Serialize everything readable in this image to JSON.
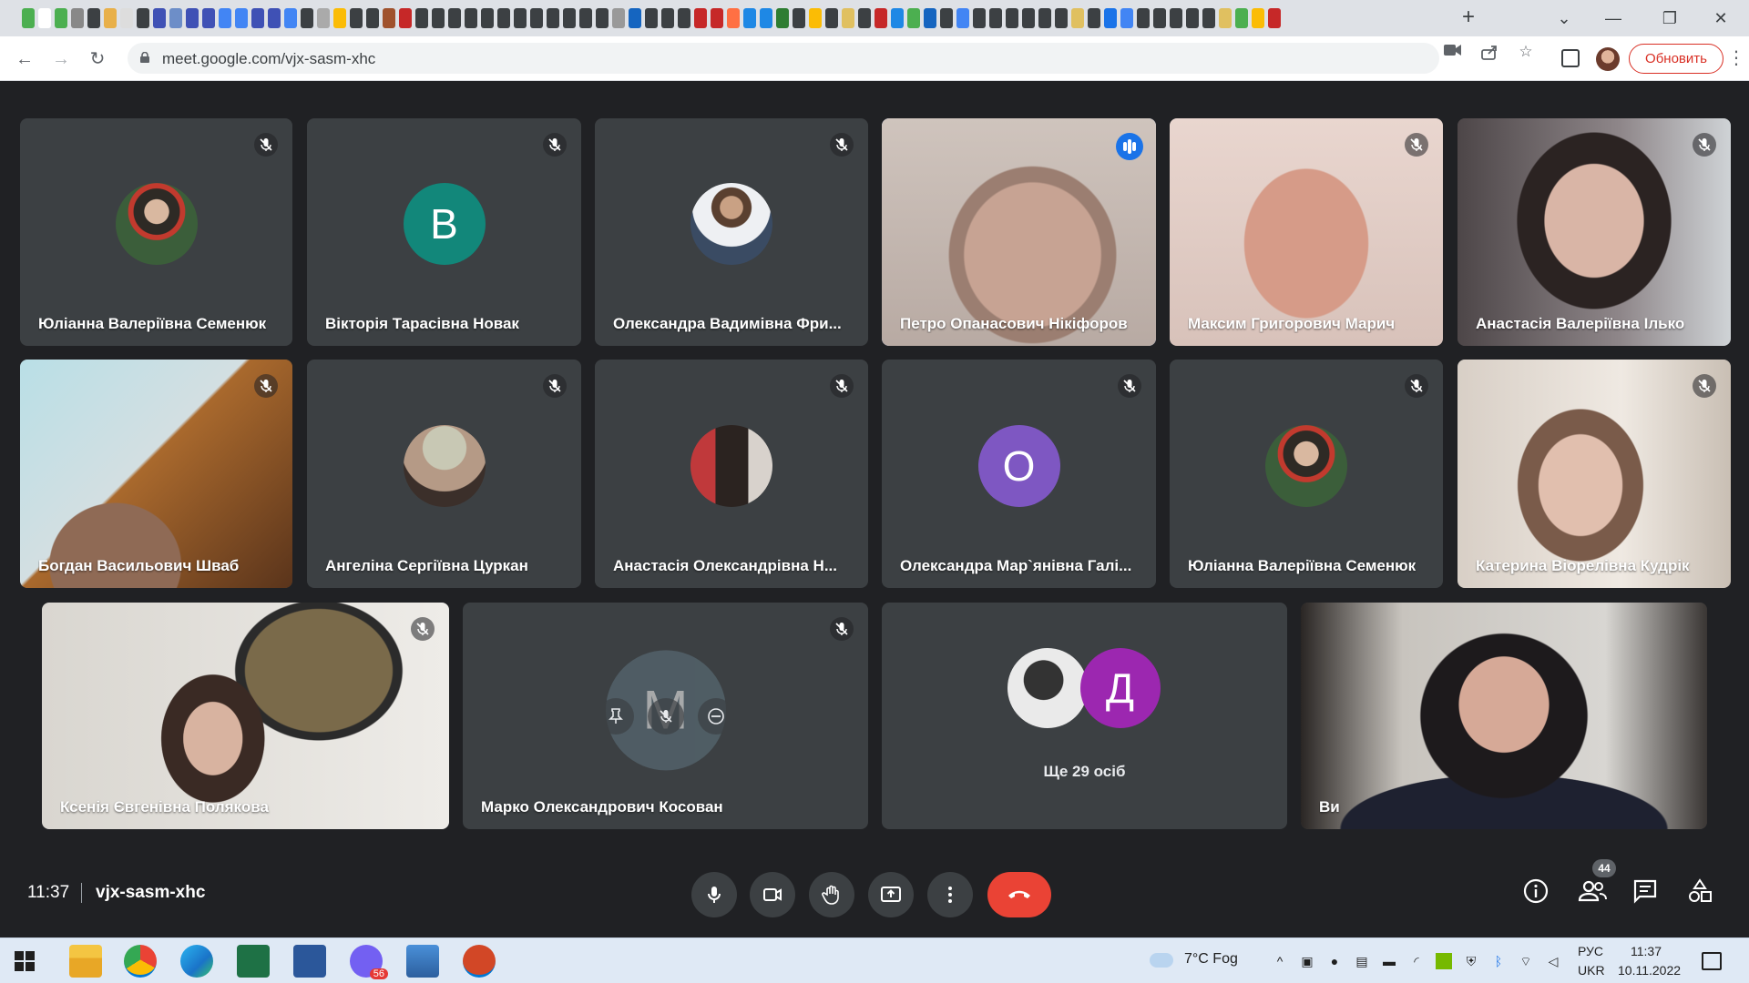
{
  "browser": {
    "url": "meet.google.com/vjx-sasm-xhc",
    "update_label": "Обновить",
    "tab_icon_colors": [
      "#4caf50",
      "#ffffff",
      "#4caf50",
      "#888",
      "#3c4043",
      "#e8b04a",
      "#ddd",
      "#3c4043",
      "#3f51b5",
      "#6d8ec8",
      "#3f51b5",
      "#3f51b5",
      "#4285f4",
      "#4285f4",
      "#3f51b5",
      "#3f51b5",
      "#4285f4",
      "#3c4043",
      "#aaa",
      "#fbbc05",
      "#3c4043",
      "#3c4043",
      "#a0522d",
      "#c62828",
      "#3c4043",
      "#3c4043",
      "#3c4043",
      "#3c4043",
      "#3c4043",
      "#3c4043",
      "#3c4043",
      "#3c4043",
      "#3c4043",
      "#3c4043",
      "#3c4043",
      "#3c4043",
      "#999",
      "#1565c0",
      "#3c4043",
      "#3c4043",
      "#3c4043",
      "#c62828",
      "#c62828",
      "#ff7043",
      "#1e88e5",
      "#1e88e5",
      "#2e7d32",
      "#3c4043",
      "#fbbc05",
      "#3c4043",
      "#e0c060",
      "#3c4043",
      "#c62828",
      "#1e88e5",
      "#4caf50",
      "#1565c0",
      "#3c4043",
      "#4285f4",
      "#3c4043",
      "#3c4043",
      "#3c4043",
      "#3c4043",
      "#3c4043",
      "#3c4043",
      "#e0c060",
      "#3c4043",
      "#1a73e8",
      "#4285f4",
      "#3c4043",
      "#3c4043",
      "#3c4043",
      "#3c4043",
      "#3c4043",
      "#e0c060",
      "#4caf50",
      "#fbbc05",
      "#c62828"
    ]
  },
  "participants": [
    {
      "name": "Юліанна Валеріївна Семенюк",
      "kind": "photo",
      "photo_color": "#3b5e3a"
    },
    {
      "name": "Вікторія Тарасівна Новак",
      "kind": "letter",
      "letter": "В",
      "color": "#12877a"
    },
    {
      "name": "Олександра Вадимівна Фри...",
      "kind": "photo",
      "photo_color": "#8a7060"
    },
    {
      "name": "Петро Опанасович Нікіфоров",
      "kind": "video",
      "speaking": true
    },
    {
      "name": "Максим Григорович Марич",
      "kind": "video"
    },
    {
      "name": "Анастасія Валеріївна Ілько",
      "kind": "video"
    },
    {
      "name": "Богдан Васильович Шваб",
      "kind": "video"
    },
    {
      "name": "Ангеліна Сергіївна Цуркан",
      "kind": "photo",
      "photo_color": "#c8c8b4"
    },
    {
      "name": "Анастасія Олександрівна Н...",
      "kind": "photo",
      "photo_color": "#4a3b33"
    },
    {
      "name": "Олександра Мар`янівна Галі...",
      "kind": "letter",
      "letter": "О",
      "color": "#7e57c2"
    },
    {
      "name": "Юліанна Валеріївна Семенюк",
      "kind": "photo",
      "photo_color": "#3b5e3a"
    },
    {
      "name": "Катерина Віорелівна Кудрік",
      "kind": "video"
    },
    {
      "name": "Ксенія Євгенівна Полякова",
      "kind": "video"
    },
    {
      "name": "Марко Олександрович Косован",
      "kind": "letter",
      "letter": "М",
      "color": "#5f7480"
    },
    {
      "more_label": "Ще 29 осіб",
      "letter": "Д",
      "color": "#9c27b0"
    },
    {
      "name": "Ви",
      "kind": "video"
    }
  ],
  "meet_bar": {
    "time": "11:37",
    "code": "vjx-sasm-xhc",
    "people_count": "44",
    "end_color": "#ea4335"
  },
  "taskbar": {
    "weather": "7°C  Fog",
    "lang_top": "РУС",
    "lang_bottom": "UKR",
    "time": "11:37",
    "date": "10.11.2022",
    "viber_badge": "56"
  }
}
